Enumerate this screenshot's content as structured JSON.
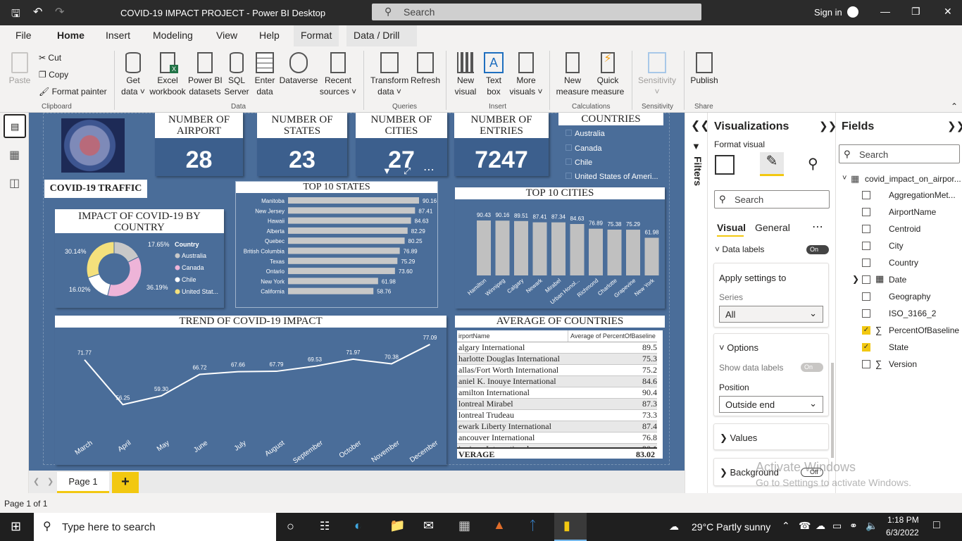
{
  "titlebar": {
    "title": "COVID-19 IMPACT PROJECT - Power BI Desktop",
    "search": "Search",
    "signin": "Sign in"
  },
  "menu": [
    "File",
    "Home",
    "Insert",
    "Modeling",
    "View",
    "Help",
    "Format",
    "Data / Drill"
  ],
  "ribbon": {
    "paste": "Paste",
    "cut": "Cut",
    "copy": "Copy",
    "format_painter": "Format painter",
    "clipboard": "Clipboard",
    "get_data": [
      "Get",
      "data"
    ],
    "excel": [
      "Excel",
      "workbook"
    ],
    "pbi_datasets": [
      "Power BI",
      "datasets"
    ],
    "sql": [
      "SQL",
      "Server"
    ],
    "enter_data": [
      "Enter",
      "data"
    ],
    "dataverse": "Dataverse",
    "recent": [
      "Recent",
      "sources"
    ],
    "data_group": "Data",
    "transform": [
      "Transform",
      "data"
    ],
    "refresh": "Refresh",
    "queries": "Queries",
    "new_visual": [
      "New",
      "visual"
    ],
    "text_box": [
      "Text",
      "box"
    ],
    "more_visuals": [
      "More",
      "visuals"
    ],
    "insert": "Insert",
    "new_measure": [
      "New",
      "measure"
    ],
    "quick_measure": [
      "Quick",
      "measure"
    ],
    "calculations": "Calculations",
    "sensitivity": "Sensitivity",
    "sensitivity_group": "Sensitivity",
    "publish": "Publish",
    "share": "Share"
  },
  "kpis": [
    {
      "title": "NUMBER OF AIRPORT",
      "value": "28"
    },
    {
      "title": "NUMBER OF STATES",
      "value": "23"
    },
    {
      "title": "NUMBER OF CITIES",
      "value": "27"
    },
    {
      "title": "NUMBER OF ENTRIES",
      "value": "7247"
    }
  ],
  "countries_slicer": {
    "title": "COUNTRIES",
    "items": [
      "Australia",
      "Canada",
      "Chile",
      "United States of Ameri..."
    ]
  },
  "traffic_label": "COVID-19 TRAFFIC",
  "chart_data": [
    {
      "type": "pie",
      "title": "IMPACT OF COVID-19 BY COUNTRY",
      "legend_title": "Country",
      "categories": [
        "Australia",
        "Canada",
        "Chile",
        "United Stat..."
      ],
      "values": [
        17.65,
        36.19,
        16.02,
        30.14
      ],
      "labels": [
        "17.65%",
        "36.19%",
        "16.02%",
        "30.14%"
      ],
      "colors": [
        "#c8c8c8",
        "#eeb4d8",
        "#ffffff",
        "#f4e07c"
      ]
    },
    {
      "type": "bar",
      "orientation": "horizontal",
      "title": "TOP 10 STATES",
      "categories": [
        "Manitoba",
        "New Jersey",
        "Hawaii",
        "Alberta",
        "Quebec",
        "British Columbia",
        "Texas",
        "Ontario",
        "New York",
        "California"
      ],
      "values": [
        90.16,
        87.41,
        84.63,
        82.29,
        80.25,
        76.89,
        75.29,
        73.6,
        61.98,
        58.76
      ],
      "labels": [
        "90.16",
        "87.41",
        "84.63",
        "82.29",
        "80.25",
        "76.89",
        "75.29",
        "73.60",
        "61.98",
        "58.76"
      ]
    },
    {
      "type": "bar",
      "title": "TOP 10 CITIES",
      "categories": [
        "Hamilton",
        "Winnipeg",
        "Calgary",
        "Newark",
        "Mirabel",
        "Urban Honol...",
        "Richmond",
        "Charlotte",
        "Grapevine",
        "New York"
      ],
      "values": [
        90.43,
        90.16,
        89.51,
        87.41,
        87.34,
        84.63,
        76.89,
        75.38,
        75.29,
        61.98
      ],
      "labels": [
        "90.43",
        "90.16",
        "89.51",
        "87.41",
        "87.34",
        "84.63",
        "76.89",
        "75.38",
        "75.29",
        "61.98"
      ]
    },
    {
      "type": "line",
      "title": "TREND OF COVID-19 IMPACT",
      "x": [
        "March",
        "April",
        "May",
        "June",
        "July",
        "August",
        "September",
        "October",
        "November",
        "December"
      ],
      "values": [
        71.77,
        56.25,
        59.3,
        66.72,
        67.66,
        67.79,
        69.53,
        71.97,
        70.38,
        77.09
      ],
      "labels": [
        "71.77",
        "56.25",
        "59.30",
        "66.72",
        "67.66",
        "67.79",
        "69.53",
        "71.97",
        "70.38",
        "77.09"
      ]
    }
  ],
  "avg_table": {
    "title": "AVERAGE OF COUNTRIES",
    "headers": [
      "irportName",
      "Average of PercentOfBaseline"
    ],
    "rows": [
      [
        "algary International",
        "89.51"
      ],
      [
        "harlotte Douglas International",
        "75.38"
      ],
      [
        "allas/Fort Worth International",
        "75.29"
      ],
      [
        "aniel K. Inouye International",
        "84.63"
      ],
      [
        "amilton International",
        "90.43"
      ],
      [
        "lontreal Mirabel",
        "87.34"
      ],
      [
        "lontreal Trudeau",
        "73.30"
      ],
      [
        "ewark Liberty International",
        "87.41"
      ],
      [
        "ancouver International",
        "76.89"
      ],
      [
        "innipeg International",
        "90.16"
      ]
    ],
    "total": [
      "VERAGE",
      "83.02"
    ]
  },
  "filters_label": "Filters",
  "viz": {
    "title": "Visualizations",
    "format_visual": "Format visual",
    "search": "Search",
    "tab_visual": "Visual",
    "tab_general": "General",
    "data_labels": "Data labels",
    "apply_settings": "Apply settings to",
    "series": "Series",
    "series_value": "All",
    "options": "Options",
    "show_data_labels": "Show data labels",
    "position": "Position",
    "position_value": "Outside end",
    "values": "Values",
    "background": "Background",
    "on": "On",
    "off": "Off"
  },
  "fields": {
    "title": "Fields",
    "search": "Search",
    "table": "covid_impact_on_airpor...",
    "items": [
      {
        "name": "AggregationMet...",
        "checked": false,
        "sigma": false
      },
      {
        "name": "AirportName",
        "checked": false,
        "sigma": false
      },
      {
        "name": "Centroid",
        "checked": false,
        "sigma": false
      },
      {
        "name": "City",
        "checked": false,
        "sigma": false
      },
      {
        "name": "Country",
        "checked": false,
        "sigma": false
      },
      {
        "name": "Date",
        "checked": false,
        "sigma": false
      },
      {
        "name": "Geography",
        "checked": false,
        "sigma": false
      },
      {
        "name": "ISO_3166_2",
        "checked": false,
        "sigma": false
      },
      {
        "name": "PercentOfBaseline",
        "checked": true,
        "sigma": true
      },
      {
        "name": "State",
        "checked": true,
        "sigma": false
      },
      {
        "name": "Version",
        "checked": false,
        "sigma": true
      }
    ]
  },
  "pages": {
    "page1": "Page 1",
    "add": "+",
    "status": "Page 1 of 1"
  },
  "watermark": [
    "Activate Windows",
    "Go to Settings to activate Windows."
  ],
  "taskbar": {
    "search": "Type here to search",
    "weather": "29°C  Partly sunny",
    "time": "1:18 PM",
    "date": "6/3/2022"
  },
  "colors": {
    "canvas": "#4a6d99",
    "kpi": "#3c5f8d",
    "accent": "#f2c811",
    "bars": "#c0c0c0"
  }
}
